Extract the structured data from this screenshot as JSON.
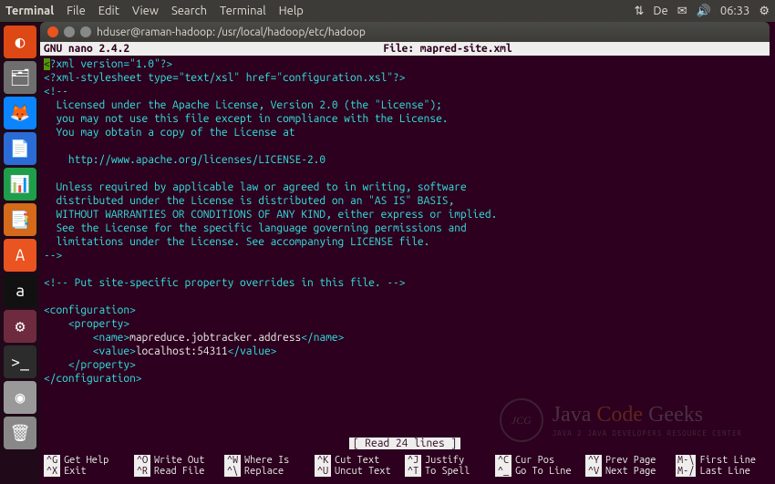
{
  "topbar": {
    "app_name": "Terminal",
    "menu": [
      "File",
      "Edit",
      "View",
      "Search",
      "Terminal",
      "Help"
    ],
    "lang": "De",
    "time": "06:33"
  },
  "launcher": {
    "items": [
      {
        "name": "dash",
        "color": "#dd4814",
        "glyph": "◐"
      },
      {
        "name": "files",
        "color": "#6e6e6e",
        "glyph": "🗂"
      },
      {
        "name": "firefox",
        "color": "#0a84ff",
        "glyph": "🦊"
      },
      {
        "name": "writer",
        "color": "#2b6bd6",
        "glyph": "📄"
      },
      {
        "name": "calc",
        "color": "#1e9e4a",
        "glyph": "📊"
      },
      {
        "name": "impress",
        "color": "#d46a1a",
        "glyph": "📑"
      },
      {
        "name": "software",
        "color": "#e95420",
        "glyph": "A"
      },
      {
        "name": "amazon",
        "color": "#111",
        "glyph": "a"
      },
      {
        "name": "settings",
        "color": "#6e2b3f",
        "glyph": "⚙"
      },
      {
        "name": "terminal",
        "color": "#2c2c2c",
        "glyph": ">_"
      },
      {
        "name": "disc",
        "color": "#999",
        "glyph": "◉"
      },
      {
        "name": "trash",
        "color": "#888",
        "glyph": "🗑"
      }
    ]
  },
  "window": {
    "title": "hduser@raman-hadoop: /usr/local/hadoop/etc/hadoop"
  },
  "nano": {
    "version": "GNU nano 2.4.2",
    "file_label": "File: mapred-site.xml",
    "status": "[ Read 24 lines ]",
    "shortcuts": [
      {
        "key": "^G",
        "label": "Get Help"
      },
      {
        "key": "^O",
        "label": "Write Out"
      },
      {
        "key": "^W",
        "label": "Where Is"
      },
      {
        "key": "^K",
        "label": "Cut Text"
      },
      {
        "key": "^J",
        "label": "Justify"
      },
      {
        "key": "^C",
        "label": "Cur Pos"
      },
      {
        "key": "^Y",
        "label": "Prev Page"
      },
      {
        "key": "M-\\",
        "label": "First Line"
      },
      {
        "key": "^X",
        "label": "Exit"
      },
      {
        "key": "^R",
        "label": "Read File"
      },
      {
        "key": "^\\",
        "label": "Replace"
      },
      {
        "key": "^U",
        "label": "Uncut Text"
      },
      {
        "key": "^T",
        "label": "To Spell"
      },
      {
        "key": "^_",
        "label": "Go To Line"
      },
      {
        "key": "^V",
        "label": "Next Page"
      },
      {
        "key": "M-/",
        "label": "Last Line"
      }
    ]
  },
  "file": {
    "l1a": "<",
    "l1b": "?xml version=\"1.0\"?>",
    "l2": "<?xml-stylesheet type=\"text/xsl\" href=\"configuration.xsl\"?>",
    "l3": "<!--",
    "l4": "  Licensed under the Apache License, Version 2.0 (the \"License\");",
    "l5": "  you may not use this file except in compliance with the License.",
    "l6": "  You may obtain a copy of the License at",
    "l7": "",
    "l8": "    http://www.apache.org/licenses/LICENSE-2.0",
    "l9": "",
    "l10": "  Unless required by applicable law or agreed to in writing, software",
    "l11": "  distributed under the License is distributed on an \"AS IS\" BASIS,",
    "l12": "  WITHOUT WARRANTIES OR CONDITIONS OF ANY KIND, either express or implied.",
    "l13": "  See the License for the specific language governing permissions and",
    "l14": "  limitations under the License. See accompanying LICENSE file.",
    "l15": "-->",
    "l16": "",
    "l17": "<!-- Put site-specific property overrides in this file. -->",
    "l18": "",
    "cfg_open": "<configuration>",
    "prop_open": "    <property>",
    "name_open": "        <name>",
    "name_val": "mapreduce.jobtracker.address",
    "name_close": "</name>",
    "value_open": "        <value>",
    "value_val": "localhost:54311",
    "value_close": "</value>",
    "prop_close": "    </property>",
    "cfg_close": "</configuration>"
  },
  "watermark": {
    "badge": "JCG",
    "line1a": "Java ",
    "line1b": "Code ",
    "line1c": "Geeks",
    "subtitle": "JAVA 2 JAVA DEVELOPERS RESOURCE CENTER"
  }
}
